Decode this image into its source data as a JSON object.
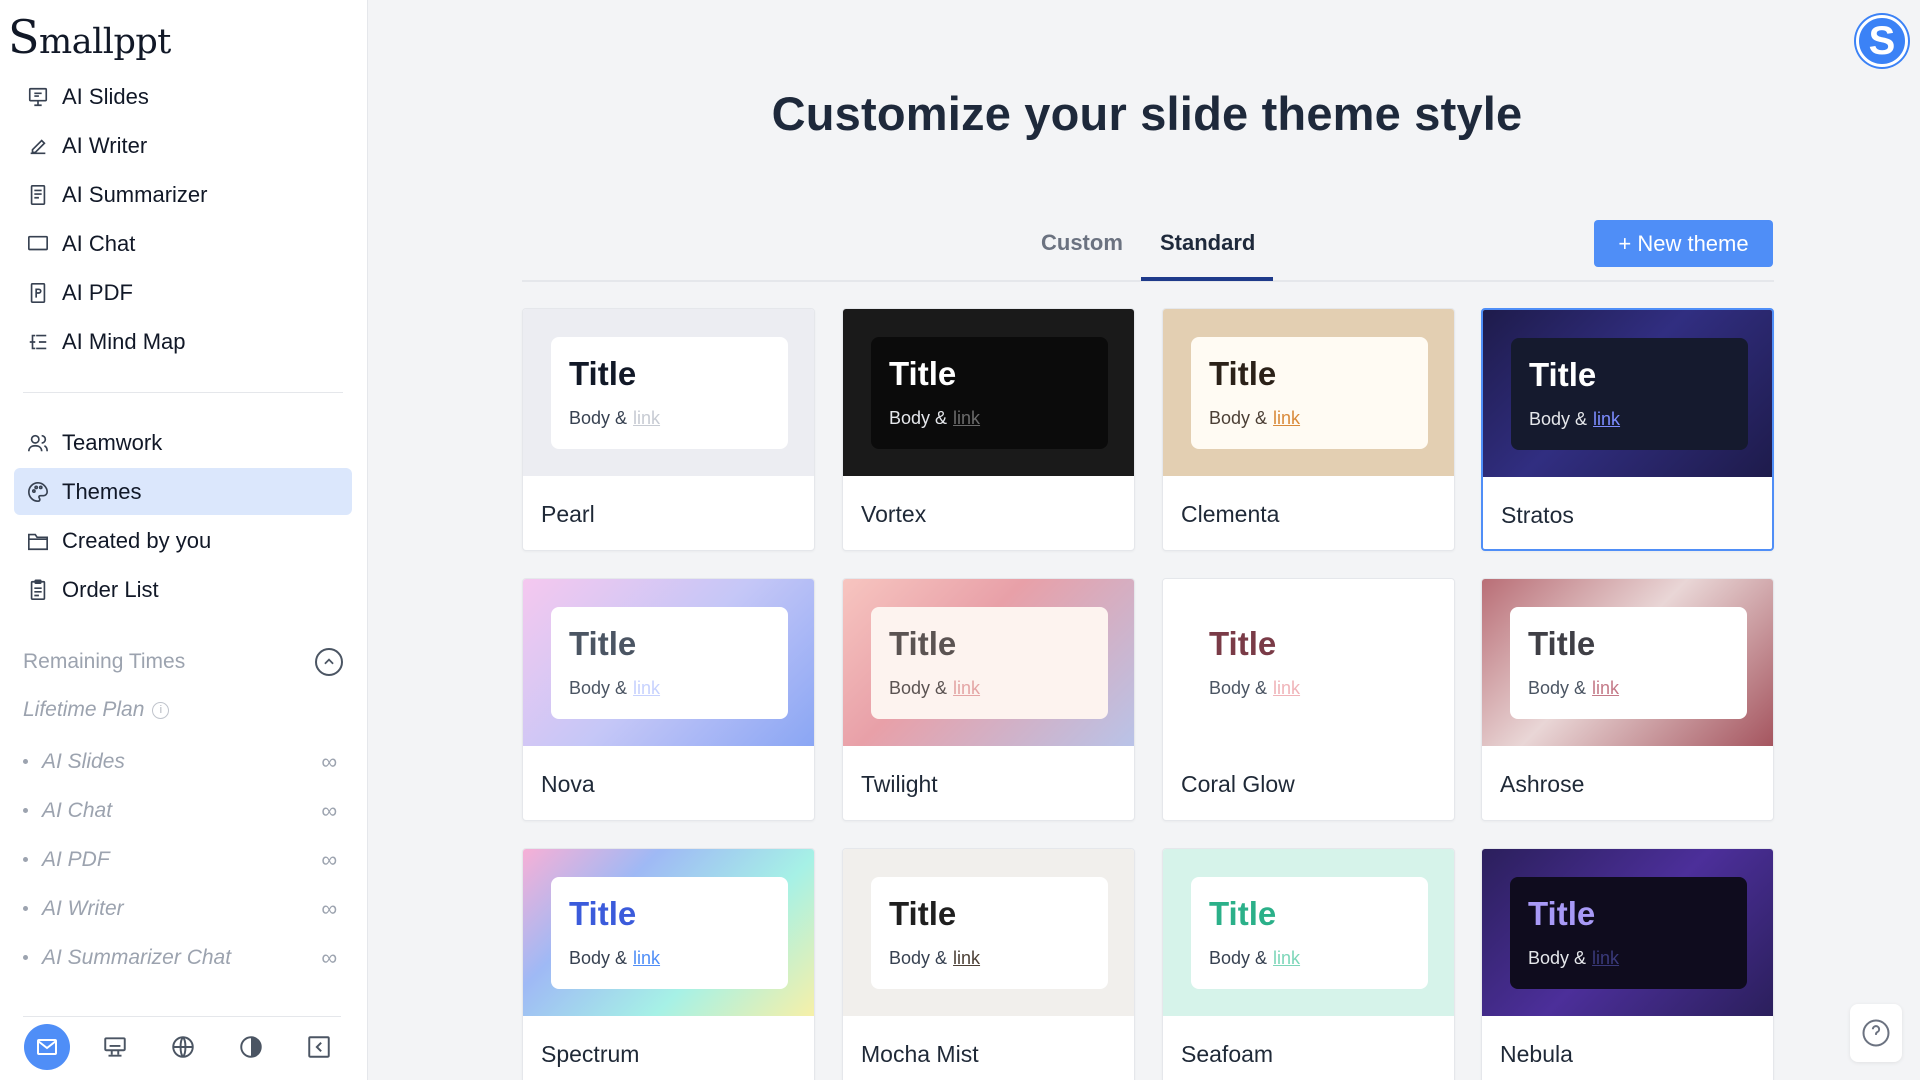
{
  "app": {
    "logo_first": "S",
    "logo_rest": "mallppt"
  },
  "sidebar": {
    "items_top": [
      {
        "label": "AI Slides",
        "icon": "presentation-icon"
      },
      {
        "label": "AI Writer",
        "icon": "pen-icon"
      },
      {
        "label": "AI Summarizer",
        "icon": "document-icon"
      },
      {
        "label": "AI Chat",
        "icon": "chat-icon"
      },
      {
        "label": "AI PDF",
        "icon": "pdf-icon"
      },
      {
        "label": "AI Mind Map",
        "icon": "mindmap-icon"
      }
    ],
    "items_bottom": [
      {
        "label": "Teamwork",
        "icon": "team-icon"
      },
      {
        "label": "Themes",
        "icon": "palette-icon",
        "active": true
      },
      {
        "label": "Created by you",
        "icon": "folder-icon"
      },
      {
        "label": "Order List",
        "icon": "clipboard-icon"
      }
    ],
    "remaining_title": "Remaining Times",
    "plan_label": "Lifetime Plan",
    "quotas": [
      {
        "label": "AI Slides",
        "value": "∞"
      },
      {
        "label": "AI Chat",
        "value": "∞"
      },
      {
        "label": "AI PDF",
        "value": "∞"
      },
      {
        "label": "AI Writer",
        "value": "∞"
      },
      {
        "label": "AI Summarizer Chat",
        "value": "∞"
      }
    ]
  },
  "header": {
    "avatar_letter": "S",
    "title": "Customize your slide theme style"
  },
  "tabs": {
    "custom": "Custom",
    "standard": "Standard",
    "active": "Standard",
    "new_theme_label": "+ New theme"
  },
  "preview_text": {
    "title": "Title",
    "body": "Body &",
    "link": "link"
  },
  "themes": [
    {
      "name": "Pearl"
    },
    {
      "name": "Vortex"
    },
    {
      "name": "Clementa"
    },
    {
      "name": "Stratos",
      "selected": true
    },
    {
      "name": "Nova"
    },
    {
      "name": "Twilight"
    },
    {
      "name": "Coral Glow"
    },
    {
      "name": "Ashrose"
    },
    {
      "name": "Spectrum"
    },
    {
      "name": "Mocha Mist"
    },
    {
      "name": "Seafoam"
    },
    {
      "name": "Nebula"
    }
  ],
  "colors": {
    "accent": "#4f8ef7",
    "active_nav_bg": "#dbe7fc",
    "heading": "#1e293b"
  }
}
